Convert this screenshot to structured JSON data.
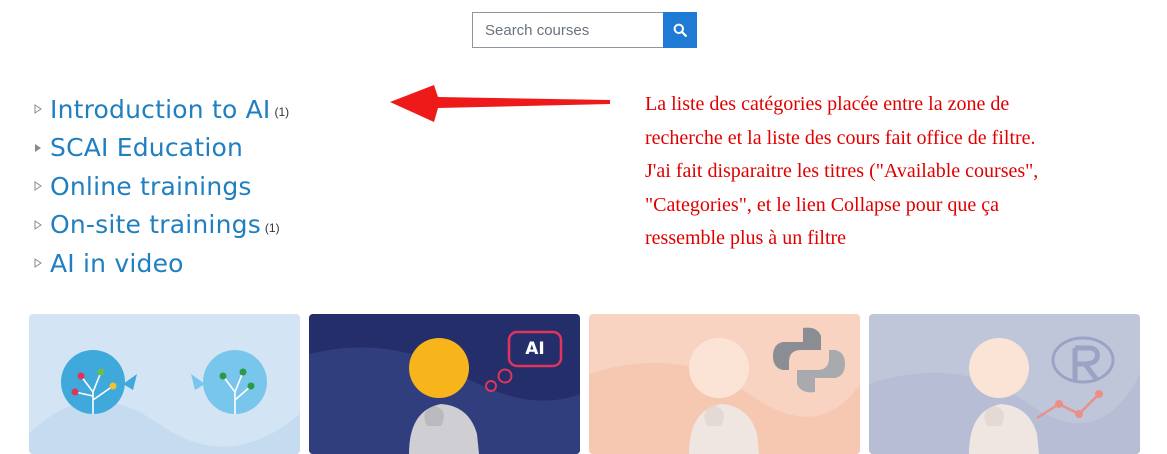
{
  "search": {
    "placeholder": "Search courses",
    "value": "",
    "button_icon": "search-icon"
  },
  "categories": [
    {
      "label": "Introduction to AI",
      "count": "(1)",
      "toggle_icon": "caret-right-outline-icon"
    },
    {
      "label": "SCAI Education",
      "count": "",
      "toggle_icon": "caret-right-filled-icon"
    },
    {
      "label": "Online trainings",
      "count": "",
      "toggle_icon": "caret-right-outline-icon"
    },
    {
      "label": "On-site trainings",
      "count": "(1)",
      "toggle_icon": "caret-right-outline-icon"
    },
    {
      "label": "AI in video",
      "count": "",
      "toggle_icon": "caret-right-outline-icon"
    }
  ],
  "annotation": {
    "lines": [
      "La liste des catégories placée entre la zone de",
      "recherche et la liste des cours fait office de filtre.",
      "J'ai fait disparaitre les titres (\"Available courses\",",
      "\"Categories\", et le lien Collapse pour que ça",
      "ressemble plus à un filtre"
    ],
    "color": "#e00000"
  },
  "course_cards": [
    {
      "image": "network-heads-illustration",
      "bg": "#d3e4f5"
    },
    {
      "image": "ai-thinker-illustration",
      "badge": "AI",
      "bg": "#242e6a"
    },
    {
      "image": "python-thinker-illustration",
      "bg": "#f8d3c1"
    },
    {
      "image": "r-thinker-illustration",
      "bg": "#c0c6da"
    }
  ],
  "colors": {
    "link": "#1f7fc0",
    "search_button": "#1f7ad6"
  }
}
